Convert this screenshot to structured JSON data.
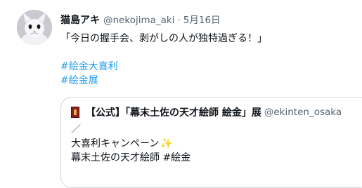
{
  "tweet": {
    "display_name": "猫島アキ",
    "handle": "@nekojima_aki",
    "separator": "·",
    "date": "5月16日",
    "text": "「今日の握手会、剥がしの人が独特過ぎる！」",
    "hashtags": [
      "#絵金大喜利",
      "#絵金展"
    ],
    "link_color": "#1d9bf0"
  },
  "quote": {
    "icon": "shrine-flag-icon",
    "display_name": "【公式】「幕末土佐の天才絵師 絵金」展",
    "handle": "@ekinten_osaka",
    "lines": [
      "／",
      "大喜利キャンペーン",
      "幕末土佐の天才絵師 "
    ],
    "sparkle": "✨",
    "hashtag": "#絵金"
  }
}
